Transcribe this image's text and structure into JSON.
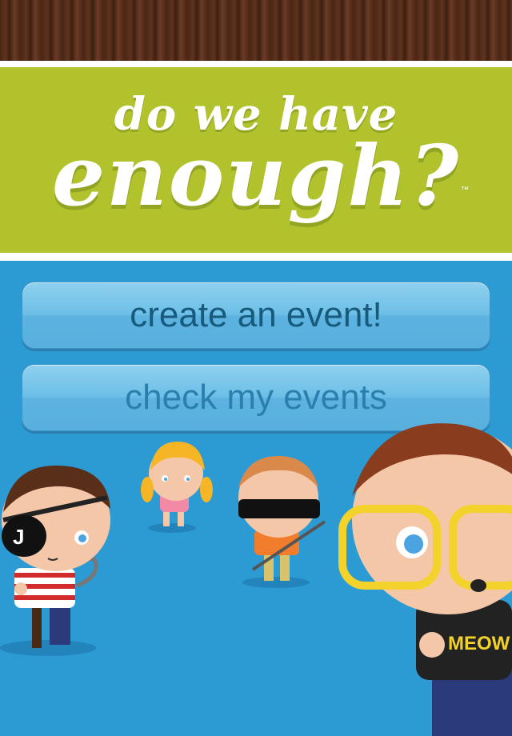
{
  "logo": {
    "line1": "do we have",
    "line2": "enough?",
    "trademark": "™"
  },
  "buttons": {
    "create": "create an event!",
    "check": "check my events"
  },
  "characters": {
    "shirt_text": "MEOW",
    "eyepatch_letter": "J"
  },
  "colors": {
    "header_green": "#b1c22d",
    "background_blue": "#2d9bd3",
    "button_blue": "#6dbfe7"
  }
}
